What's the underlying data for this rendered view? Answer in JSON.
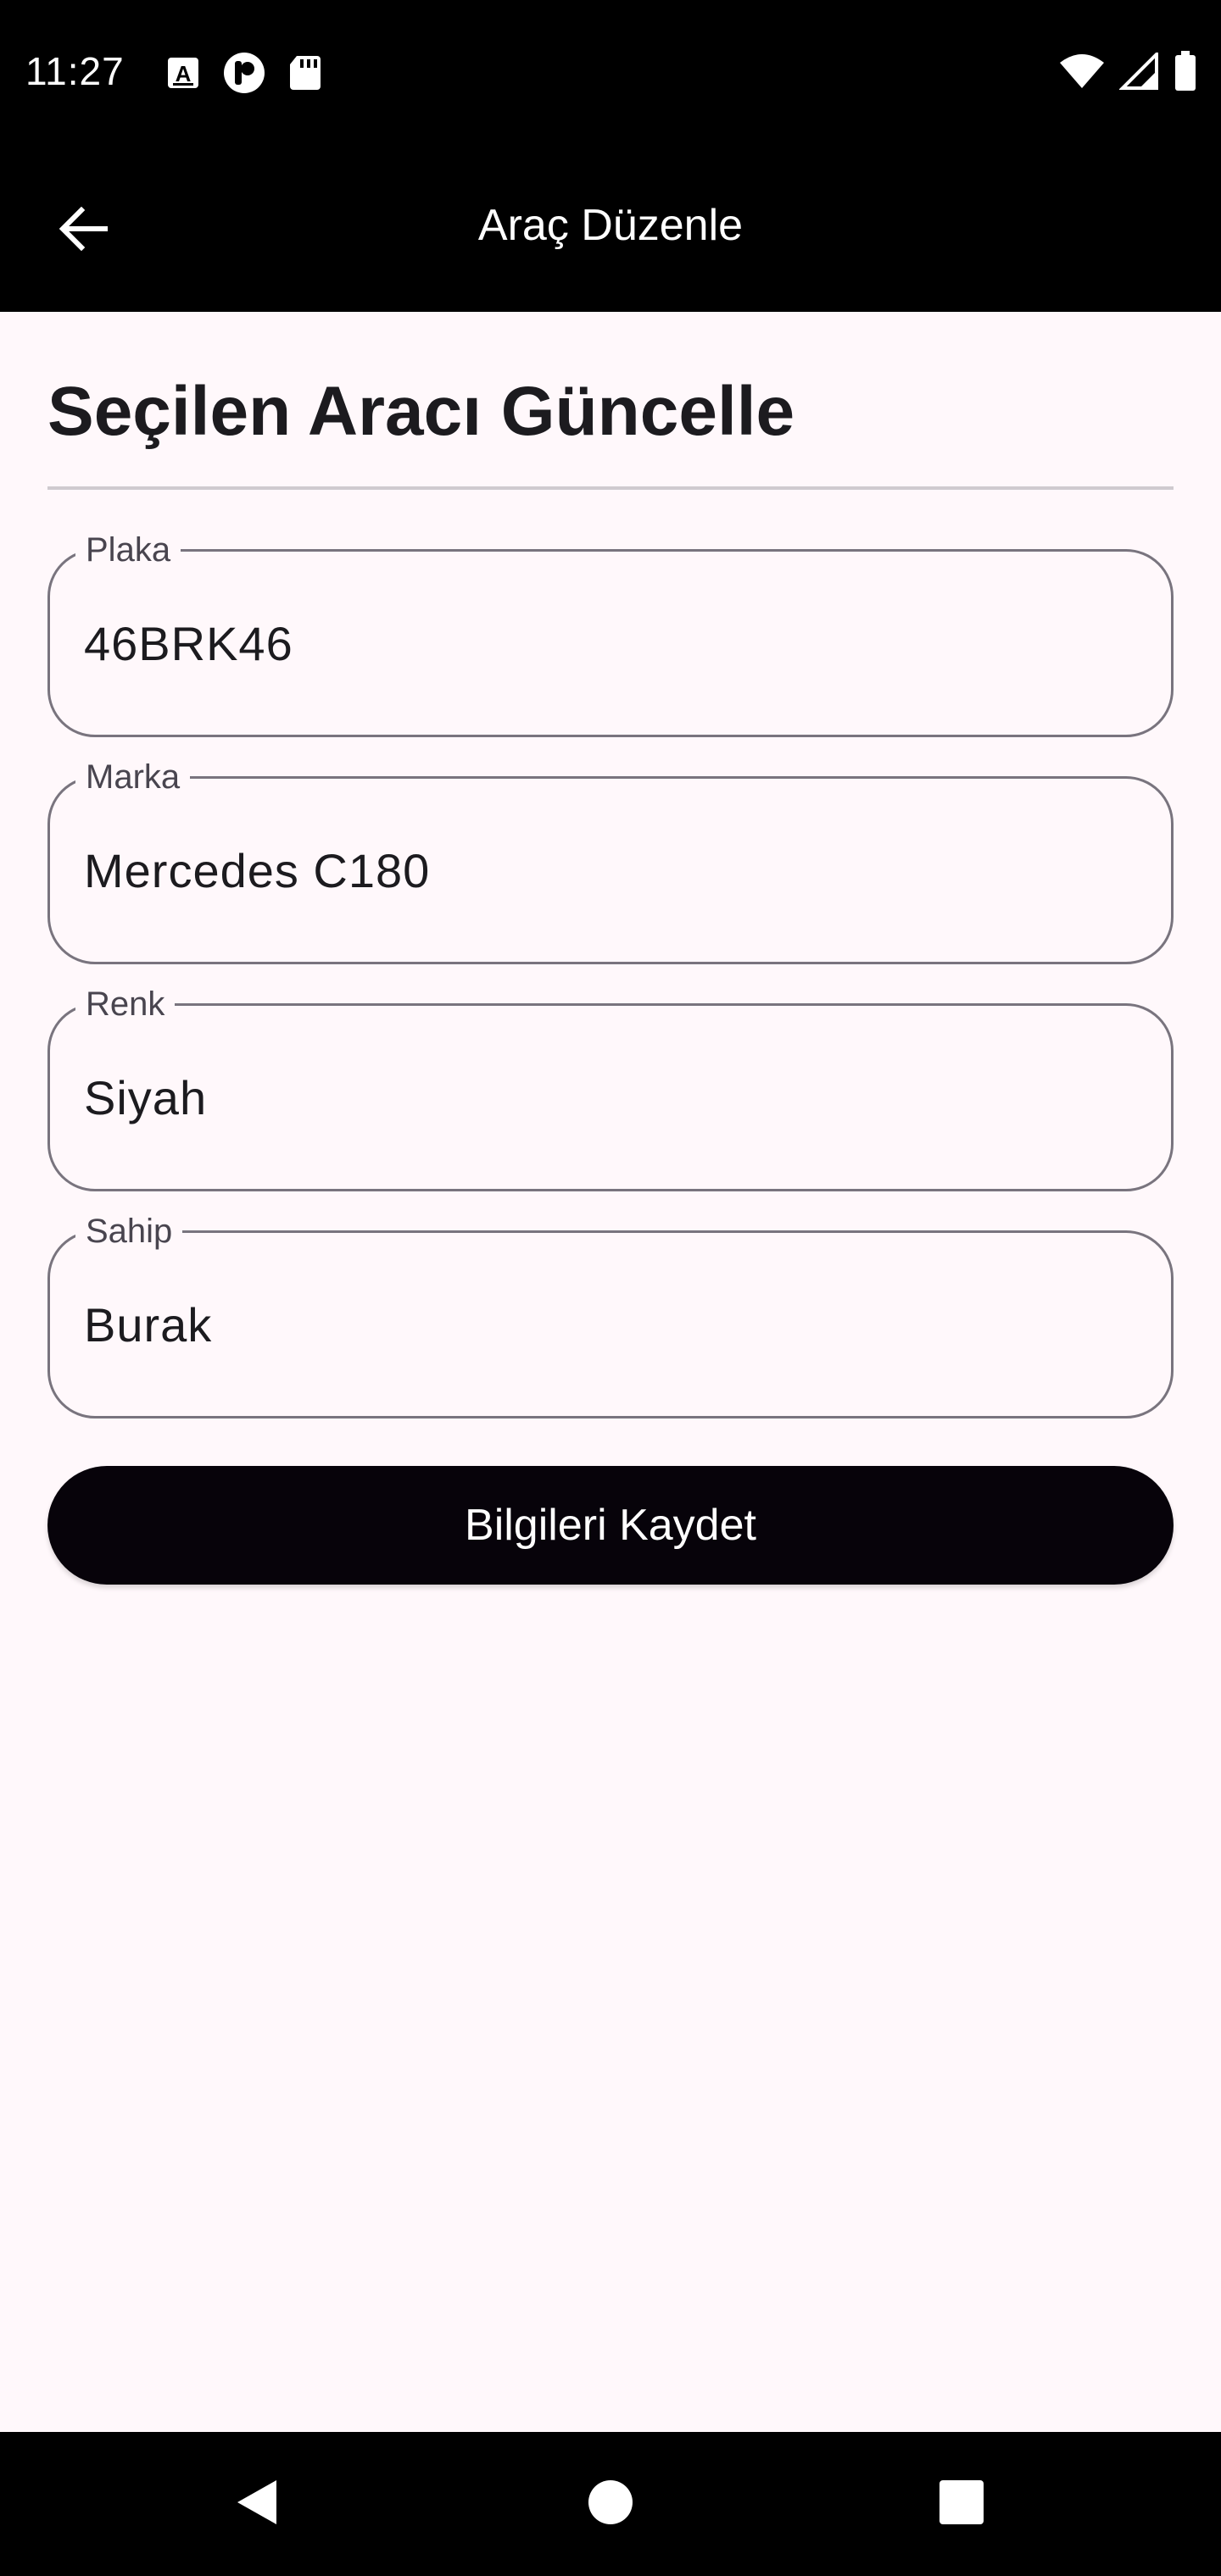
{
  "status_bar": {
    "time": "11:27",
    "left_icons": [
      "text-a-icon",
      "p-app-icon",
      "sd-card-icon"
    ],
    "right_icons": [
      "wifi-icon",
      "cell-signal-icon",
      "battery-icon"
    ]
  },
  "app_bar": {
    "title": "Araç Düzenle",
    "back_icon": "arrow-left-icon"
  },
  "page": {
    "title": "Seçilen Aracı Güncelle"
  },
  "form": {
    "plate": {
      "label": "Plaka",
      "value": "46BRK46"
    },
    "brand": {
      "label": "Marka",
      "value": "Mercedes C180"
    },
    "color": {
      "label": "Renk",
      "value": "Siyah"
    },
    "owner": {
      "label": "Sahip",
      "value": "Burak"
    },
    "save_label": "Bilgileri Kaydet"
  },
  "nav_bar": {
    "icons": [
      "back-triangle-icon",
      "home-circle-icon",
      "recents-square-icon"
    ]
  },
  "colors": {
    "bar": "#000000",
    "background": "#fff8fb",
    "outline": "#79747e",
    "button": "#07030a"
  }
}
